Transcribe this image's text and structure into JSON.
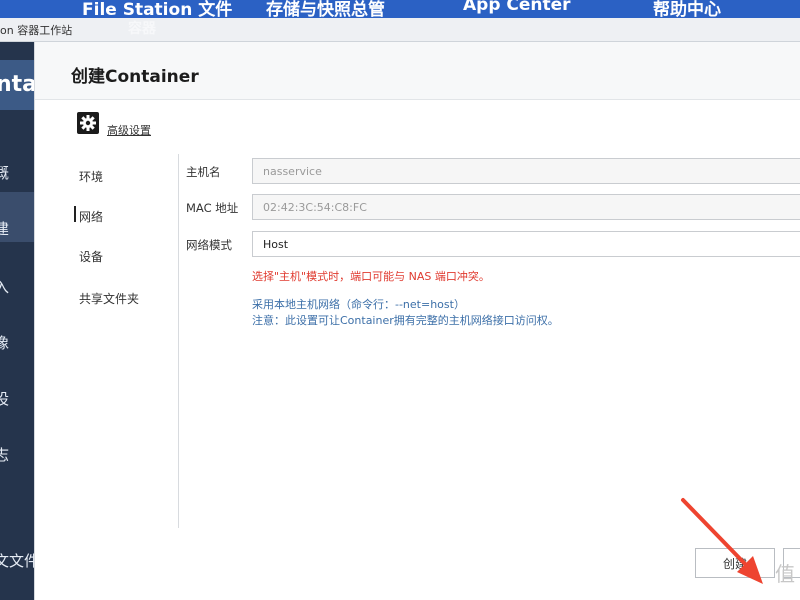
{
  "taskbar": {
    "items": [
      "File Station 文件",
      "存储与快照总管",
      "App Center",
      "帮助中心"
    ],
    "ghost_text": "容器"
  },
  "app": {
    "title": "on 容器工作站",
    "sidebar_header": "ntai",
    "sidebar_items": [
      "概",
      "建",
      "入",
      "像",
      "设",
      "志",
      "文文件"
    ]
  },
  "dialog": {
    "title": "创建Container",
    "advanced_label": "高级设置",
    "tabs": [
      "环境",
      "网络",
      "设备",
      "共享文件夹"
    ],
    "active_tab": "网络",
    "form": {
      "hostname_label": "主机名",
      "hostname_placeholder": "nasservice",
      "mac_label": "MAC 地址",
      "mac_value": "02:42:3C:54:C8:FC",
      "mode_label": "网络模式",
      "mode_value": "Host"
    },
    "warning": "选择\"主机\"模式时，端口可能与 NAS 端口冲突。",
    "hint_line1": "采用本地主机网络（命令行：--net=host）",
    "hint_line2": "注意：此设置可让Container拥有完整的主机网络接口访问权。",
    "create_button": "创建",
    "watermark": "值"
  },
  "colors": {
    "taskbar": "#2b61c4",
    "warning": "#e03a2f",
    "hint": "#3c6fa8",
    "arrow": "#ee4430"
  }
}
